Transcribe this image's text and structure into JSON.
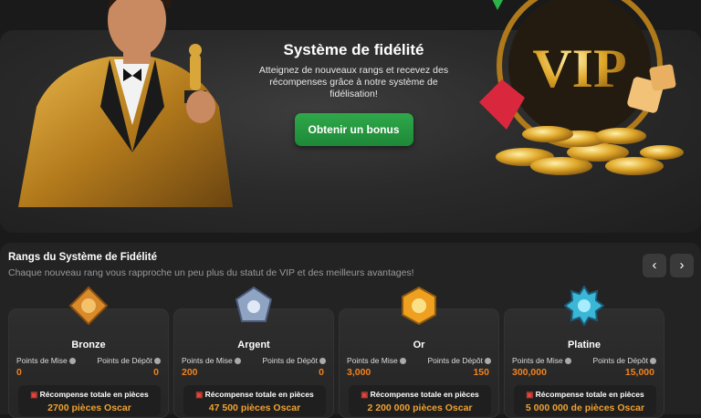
{
  "hero": {
    "title": "Système de fidélité",
    "subtitle": "Atteignez de nouveaux rangs et recevez des récompenses grâce à notre système de fidélisation!",
    "button": "Obtenir un bonus",
    "vip_text": "VIP"
  },
  "ranks": {
    "title": "Rangs du Système de Fidélité",
    "subtitle": "Chaque nouveau rang vous rapproche un peu plus du statut de VIP et des meilleurs avantages!",
    "prev_icon": "chevron-left-icon",
    "next_icon": "chevron-right-icon",
    "labels": {
      "bet": "Points de Mise",
      "deposit": "Points de Dépôt",
      "reward": "Récompense totale en pièces"
    },
    "cards": [
      {
        "name": "Bronze",
        "bet": "0",
        "deposit": "0",
        "reward": "2700 pièces Oscar",
        "color": "#d98a2a"
      },
      {
        "name": "Argent",
        "bet": "200",
        "deposit": "0",
        "reward": "47 500 pièces Oscar",
        "color": "#8fa3c2"
      },
      {
        "name": "Or",
        "bet": "3,000",
        "deposit": "150",
        "reward": "2 200 000 pièces Oscar",
        "color": "#f0a020"
      },
      {
        "name": "Platine",
        "bet": "300,000",
        "deposit": "15,000",
        "reward": "5 000 000 de pièces Oscar",
        "color": "#3ab7d6"
      }
    ]
  }
}
